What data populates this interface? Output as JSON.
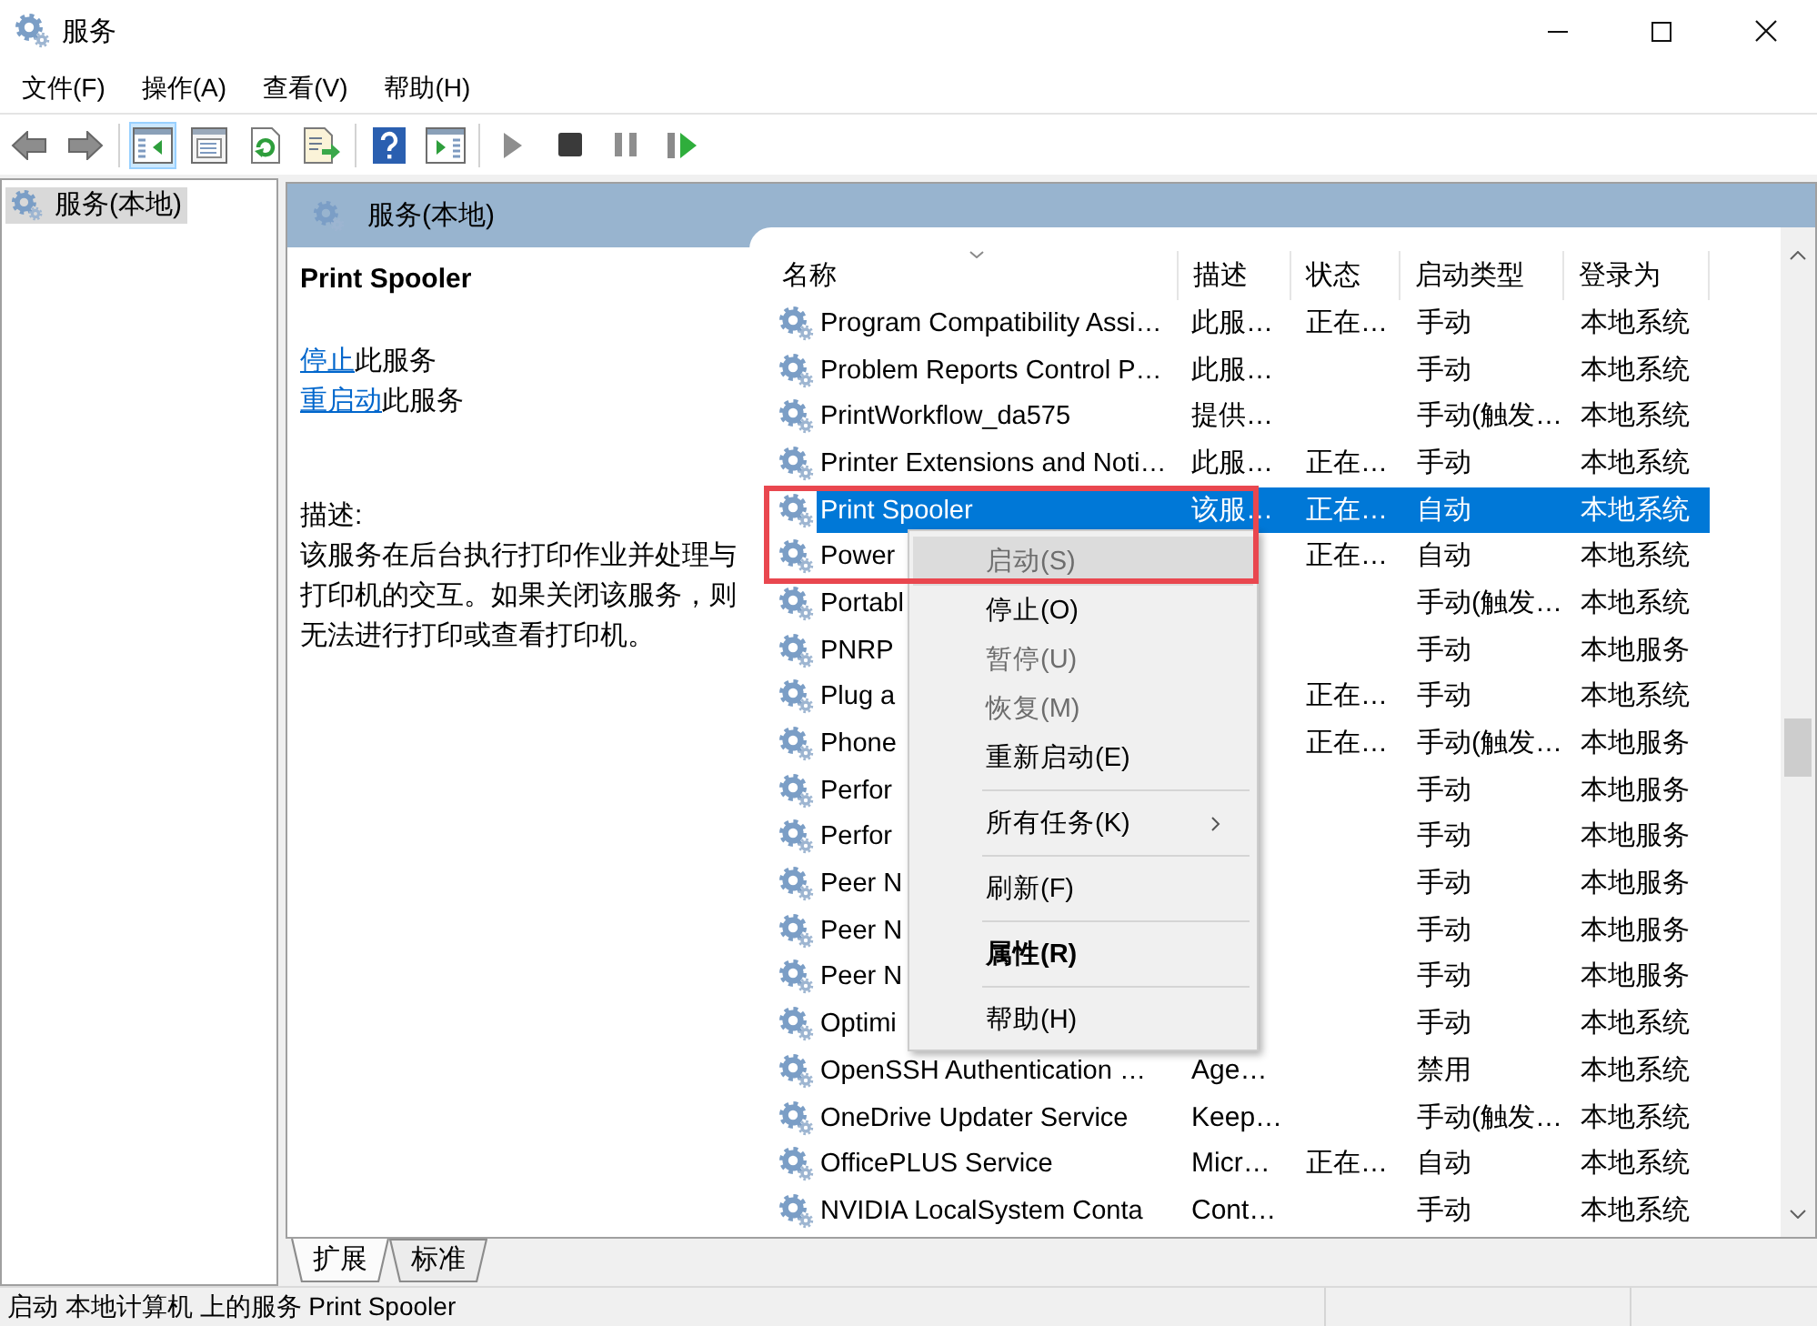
{
  "window": {
    "title": "服务"
  },
  "menu_bar": [
    "文件(F)",
    "操作(A)",
    "查看(V)",
    "帮助(H)"
  ],
  "toolbar": [
    {
      "kind": "back",
      "pressed": false,
      "disabled": false
    },
    {
      "kind": "forward",
      "pressed": false,
      "disabled": false
    },
    {
      "kind": "separator"
    },
    {
      "kind": "console_tree",
      "pressed": true,
      "disabled": false
    },
    {
      "kind": "properties",
      "pressed": false,
      "disabled": false
    },
    {
      "kind": "refresh",
      "pressed": false,
      "disabled": false
    },
    {
      "kind": "export",
      "pressed": false,
      "disabled": false
    },
    {
      "kind": "separator"
    },
    {
      "kind": "help",
      "pressed": false,
      "disabled": false
    },
    {
      "kind": "action_pane",
      "pressed": false,
      "disabled": false
    },
    {
      "kind": "separator"
    },
    {
      "kind": "start",
      "pressed": false,
      "disabled": true
    },
    {
      "kind": "stop",
      "pressed": false,
      "disabled": false
    },
    {
      "kind": "pause",
      "pressed": false,
      "disabled": true
    },
    {
      "kind": "restart",
      "pressed": false,
      "disabled": false
    }
  ],
  "tree": {
    "items": [
      {
        "label": "服务(本地)",
        "selected": true
      }
    ]
  },
  "panel": {
    "title": "服务(本地)"
  },
  "detail": {
    "title": "Print Spooler",
    "actions": [
      {
        "link": "停止",
        "text": "此服务"
      },
      {
        "link": "重启动",
        "text": "此服务"
      }
    ],
    "description_label": "描述:",
    "description": "该服务在后台执行打印作业并处理与打印机的交互。如果关闭该服务，则无法进行打印或查看打印机。"
  },
  "services": {
    "columns": [
      "名称",
      "描述",
      "状态",
      "启动类型",
      "登录为"
    ],
    "rows": [
      {
        "name": "Program Compatibility Assi…",
        "description": "此服…",
        "status": "正在…",
        "startup_type": "手动",
        "log_on_as": "本地系统",
        "selected": false
      },
      {
        "name": "Problem Reports Control P…",
        "description": "此服…",
        "startup_type": "手动",
        "log_on_as": "本地系统",
        "selected": false
      },
      {
        "name": "PrintWorkflow_da575",
        "description": "提供…",
        "startup_type": "手动(触发…",
        "log_on_as": "本地系统",
        "selected": false
      },
      {
        "name": "Printer Extensions and Noti…",
        "description": "此服…",
        "status": "正在…",
        "startup_type": "手动",
        "log_on_as": "本地系统",
        "selected": false
      },
      {
        "name": "Print Spooler",
        "description": "该服…",
        "status": "正在…",
        "startup_type": "自动",
        "log_on_as": "本地系统",
        "selected": true
      },
      {
        "name": "Power",
        "status": "正在…",
        "startup_type": "自动",
        "log_on_as": "本地系统",
        "selected": false
      },
      {
        "name": "Portabl",
        "startup_type": "手动(触发…",
        "log_on_as": "本地系统",
        "selected": false
      },
      {
        "name": "PNRP",
        "startup_type": "手动",
        "log_on_as": "本地服务",
        "selected": false
      },
      {
        "name": "Plug a",
        "status": "正在…",
        "startup_type": "手动",
        "log_on_as": "本地系统",
        "selected": false
      },
      {
        "name": "Phone",
        "status": "正在…",
        "startup_type": "手动(触发…",
        "log_on_as": "本地服务",
        "selected": false
      },
      {
        "name": "Perfor",
        "startup_type": "手动",
        "log_on_as": "本地服务",
        "selected": false
      },
      {
        "name": "Perfor",
        "startup_type": "手动",
        "log_on_as": "本地服务",
        "selected": false
      },
      {
        "name": "Peer N",
        "startup_type": "手动",
        "log_on_as": "本地服务",
        "selected": false
      },
      {
        "name": "Peer N",
        "startup_type": "手动",
        "log_on_as": "本地服务",
        "selected": false
      },
      {
        "name": "Peer N",
        "startup_type": "手动",
        "log_on_as": "本地服务",
        "selected": false
      },
      {
        "name": "Optimi",
        "startup_type": "手动",
        "log_on_as": "本地系统",
        "selected": false
      },
      {
        "name": "OpenSSH Authentication …",
        "description": "Age…",
        "startup_type": "禁用",
        "log_on_as": "本地系统",
        "selected": false
      },
      {
        "name": "OneDrive Updater Service",
        "description": "Keep…",
        "startup_type": "手动(触发…",
        "log_on_as": "本地系统",
        "selected": false
      },
      {
        "name": "OfficePLUS Service",
        "description": "Micr…",
        "status": "正在…",
        "startup_type": "自动",
        "log_on_as": "本地系统",
        "selected": false
      },
      {
        "name": "NVIDIA LocalSystem Conta",
        "description": "Cont…",
        "startup_type": "手动",
        "log_on_as": "本地系统",
        "selected": false
      }
    ]
  },
  "context_menu": {
    "framed": true,
    "items": [
      {
        "kind": "command",
        "label": "启动(S)",
        "disabled": true,
        "hovered": true,
        "default": false,
        "submenu": false
      },
      {
        "kind": "command",
        "label": "停止(O)",
        "disabled": false,
        "hovered": false,
        "default": false,
        "submenu": false
      },
      {
        "kind": "command",
        "label": "暂停(U)",
        "disabled": true,
        "hovered": false,
        "default": false,
        "submenu": false
      },
      {
        "kind": "command",
        "label": "恢复(M)",
        "disabled": true,
        "hovered": false,
        "default": false,
        "submenu": false
      },
      {
        "kind": "command",
        "label": "重新启动(E)",
        "disabled": false,
        "hovered": false,
        "default": false,
        "submenu": false
      },
      {
        "kind": "separator"
      },
      {
        "kind": "command",
        "label": "所有任务(K)",
        "disabled": false,
        "hovered": false,
        "default": false,
        "submenu": true
      },
      {
        "kind": "separator"
      },
      {
        "kind": "command",
        "label": "刷新(F)",
        "disabled": false,
        "hovered": false,
        "default": false,
        "submenu": false
      },
      {
        "kind": "separator"
      },
      {
        "kind": "command",
        "label": "属性(R)",
        "disabled": false,
        "hovered": false,
        "default": true,
        "submenu": false
      },
      {
        "kind": "separator"
      },
      {
        "kind": "command",
        "label": "帮助(H)",
        "disabled": false,
        "hovered": false,
        "default": false,
        "submenu": false
      }
    ]
  },
  "view_tabs": [
    {
      "label": "扩展",
      "selected": true
    },
    {
      "label": "标准",
      "selected": false
    }
  ],
  "status_bar": {
    "text": "启动 本地计算机 上的服务 Print Spooler"
  }
}
